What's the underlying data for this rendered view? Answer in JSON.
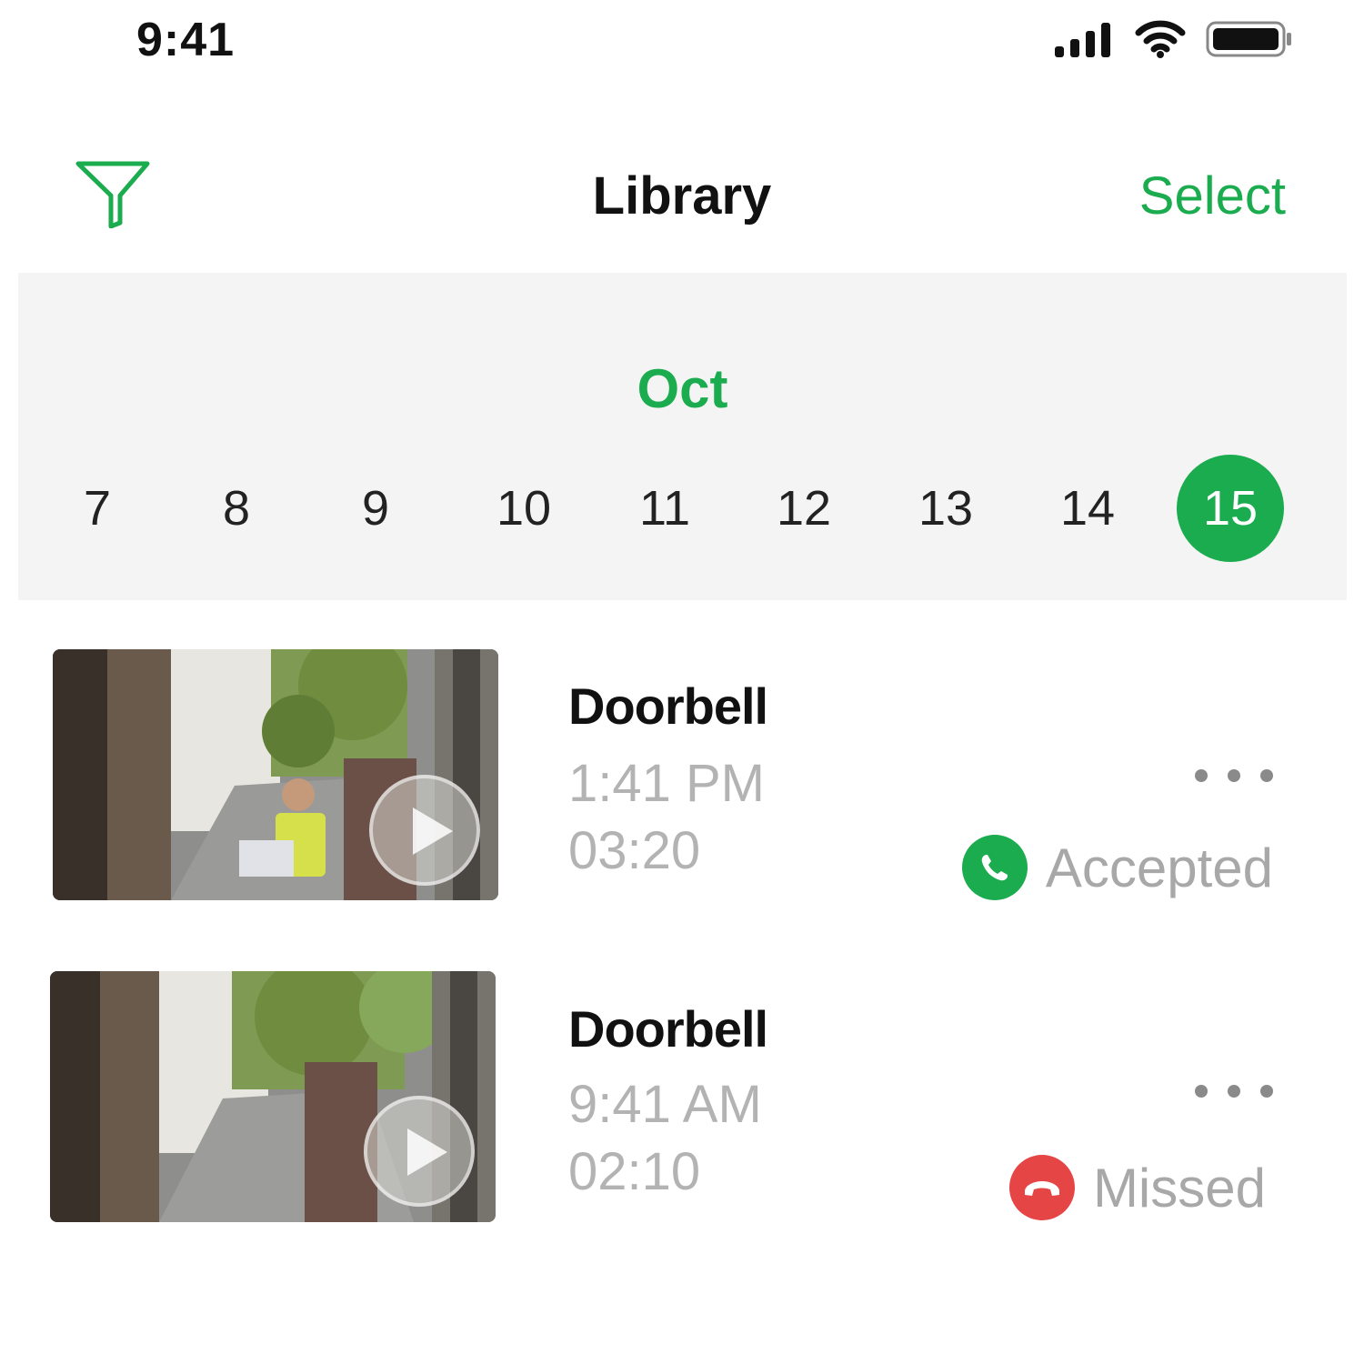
{
  "status_bar": {
    "time": "9:41"
  },
  "nav": {
    "title": "Library",
    "select_label": "Select"
  },
  "calendar": {
    "month": "Oct",
    "days": [
      "7",
      "8",
      "9",
      "10",
      "11",
      "12",
      "13",
      "14",
      "15"
    ],
    "selected_day": "15"
  },
  "events": [
    {
      "title": "Doorbell",
      "time": "1:41 PM",
      "duration": "03:20",
      "status": "Accepted",
      "status_color": "#1aac4e",
      "status_icon": "phone-accepted-icon"
    },
    {
      "title": "Doorbell",
      "time": "9:41 AM",
      "duration": "02:10",
      "status": "Missed",
      "status_color": "#e64545",
      "status_icon": "phone-hangup-icon"
    }
  ],
  "colors": {
    "accent": "#1aac4e",
    "missed": "#e64545",
    "strip_bg": "#f4f4f4",
    "secondary_text": "#b3b3b3"
  }
}
